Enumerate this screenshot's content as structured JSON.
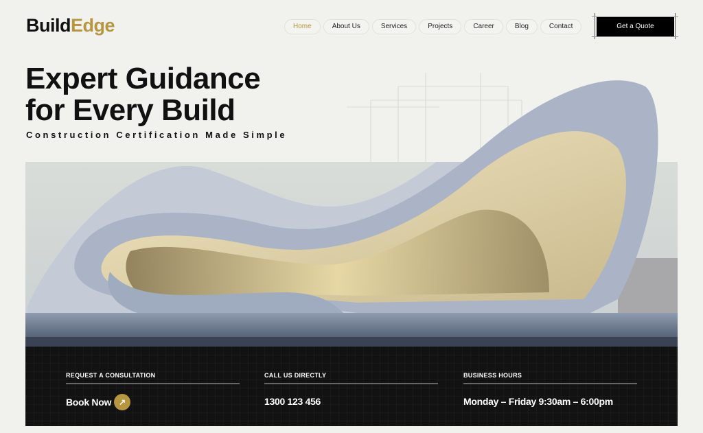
{
  "logo": {
    "part1": "Build",
    "part2": "Edge"
  },
  "nav": {
    "items": [
      {
        "label": "Home",
        "active": true
      },
      {
        "label": "About Us"
      },
      {
        "label": "Services"
      },
      {
        "label": "Projects"
      },
      {
        "label": "Career"
      },
      {
        "label": "Blog"
      },
      {
        "label": "Contact"
      }
    ],
    "cta": "Get a Quote"
  },
  "hero": {
    "title_line1": "Expert Guidance",
    "title_line2": "for Every Build",
    "subtitle": "Construction Certification Made Simple"
  },
  "info": [
    {
      "label": "REQUEST A CONSULTATION",
      "value": "Book Now",
      "icon": "arrow-up-right-icon"
    },
    {
      "label": "CALL US DIRECTLY",
      "value": "1300 123 456"
    },
    {
      "label": "BUSINESS HOURS",
      "value": "Monday – Friday 9:30am – 6:00pm"
    }
  ],
  "colors": {
    "accent": "#b8963f",
    "background": "#f1f1ed",
    "panel": "#121212"
  }
}
